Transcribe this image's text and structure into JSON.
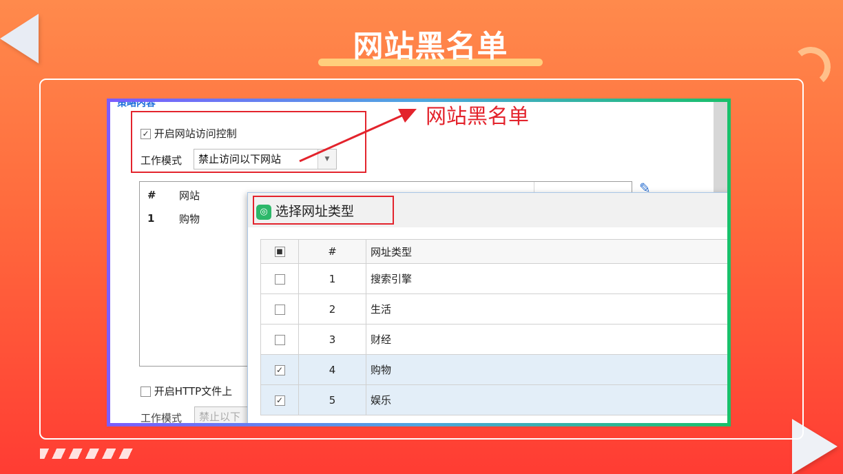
{
  "slide": {
    "title": "网站黑名单"
  },
  "screenshot": {
    "section_title": "策略内容",
    "annotation": "网站黑名单",
    "enable_access_control": {
      "label": "开启网站访问控制",
      "checked": true
    },
    "work_mode": {
      "label": "工作模式",
      "value": "禁止访问以下网站"
    },
    "site_list": {
      "headers": [
        "#",
        "网站"
      ],
      "rows": [
        {
          "num": "1",
          "site": "购物"
        }
      ]
    },
    "enable_http_upload": {
      "label": "开启HTTP文件上",
      "checked": false
    },
    "work_mode_2": {
      "label": "工作模式",
      "value": "禁止以下"
    },
    "dialog": {
      "title": "选择网址类型",
      "headers": [
        "#",
        "网址类型"
      ],
      "rows": [
        {
          "num": "1",
          "type": "搜索引擎",
          "checked": false
        },
        {
          "num": "2",
          "type": "生活",
          "checked": false
        },
        {
          "num": "3",
          "type": "财经",
          "checked": false
        },
        {
          "num": "4",
          "type": "购物",
          "checked": true
        },
        {
          "num": "5",
          "type": "娱乐",
          "checked": true
        }
      ]
    }
  },
  "colors": {
    "annotation_red": "#e3232c",
    "selected_row": "#e3eef8",
    "title_underline": "#ffcf7c"
  }
}
